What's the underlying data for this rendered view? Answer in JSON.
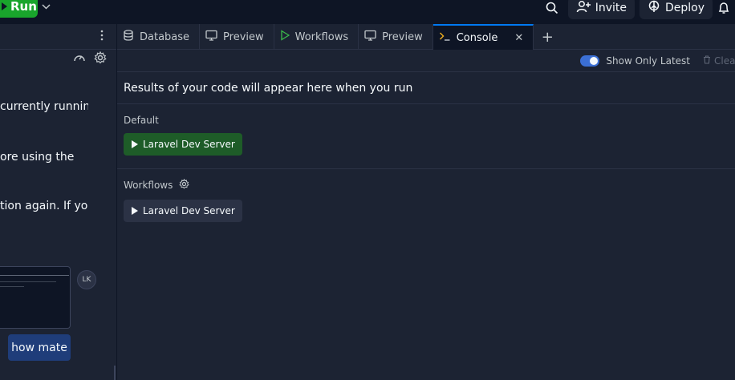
{
  "topbar": {
    "run_label": "Run",
    "invite_label": "Invite",
    "deploy_label": "Deploy"
  },
  "left_panel": {
    "text_lines": [
      "currently running",
      "ore using the",
      "tion again. If you"
    ],
    "avatar_initials": "LK",
    "chip_label": "how mate"
  },
  "tabs": [
    {
      "label": "Database",
      "icon": "database-icon",
      "active": false
    },
    {
      "label": "Preview",
      "icon": "monitor-icon",
      "active": false
    },
    {
      "label": "Workflows",
      "icon": "play-icon",
      "active": false
    },
    {
      "label": "Preview",
      "icon": "monitor-icon",
      "active": false
    },
    {
      "label": "Console",
      "icon": "terminal-icon",
      "active": true
    }
  ],
  "console": {
    "toggle_label": "Show Only Latest",
    "toggle_on": true,
    "clear_label": "Clear",
    "message": "Results of your code will appear here when you run",
    "default_section": {
      "label": "Default",
      "button_label": "Laravel Dev Server"
    },
    "workflows_section": {
      "label": "Workflows",
      "button_label": "Laravel Dev Server"
    }
  },
  "colors": {
    "background": "#0e1525",
    "panel": "#1c2333",
    "accent_blue": "#0079f2",
    "run_green": "#19a52c",
    "server_green": "#1e5c28"
  }
}
